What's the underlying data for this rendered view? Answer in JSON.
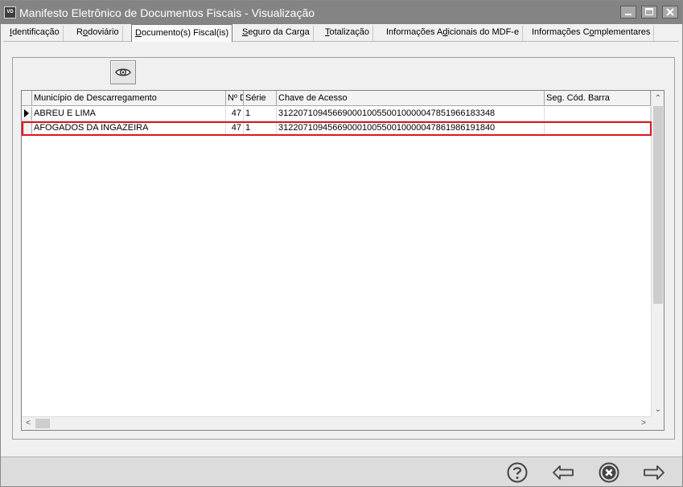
{
  "window": {
    "icon_text": "VD",
    "title": "Manifesto Eletrônico de Documentos Fiscais - Visualização"
  },
  "tabs": [
    {
      "label": "Identificação",
      "underline_index": 0
    },
    {
      "label": "Rodoviário",
      "underline_index": 1
    },
    {
      "label": "Documento(s) Fiscal(is)",
      "underline_index": 0,
      "active": true
    },
    {
      "label": "Seguro da Carga",
      "underline_index": 0
    },
    {
      "label": "Totalização",
      "underline_index": 0
    },
    {
      "label": "Informações Adicionais do MDF-e",
      "underline_index": 13
    },
    {
      "label": "Informações Complementares",
      "underline_index": 13
    }
  ],
  "toolbar": {
    "view_icon": "eye-icon"
  },
  "grid": {
    "columns": [
      "Município de Descarregamento",
      "Nº D",
      "Série",
      "Chave de Acesso",
      "Seg. Cód. Barra"
    ],
    "rows": [
      {
        "municipio": "ABREU E LIMA",
        "numero": "47",
        "serie": "1",
        "chave": "31220710945669000100550010000047851966183348",
        "seg": "",
        "current": true
      },
      {
        "municipio": "AFOGADOS DA INGAZEIRA",
        "numero": "47",
        "serie": "1",
        "chave": "31220710945669000100550010000047861986191840",
        "seg": "",
        "highlighted": true
      }
    ]
  },
  "footer": {
    "buttons": [
      "help-icon",
      "back-arrow-icon",
      "close-circle-icon",
      "forward-arrow-icon"
    ]
  },
  "colors": {
    "titlebar": "#848484",
    "highlight": "#e0161e"
  }
}
